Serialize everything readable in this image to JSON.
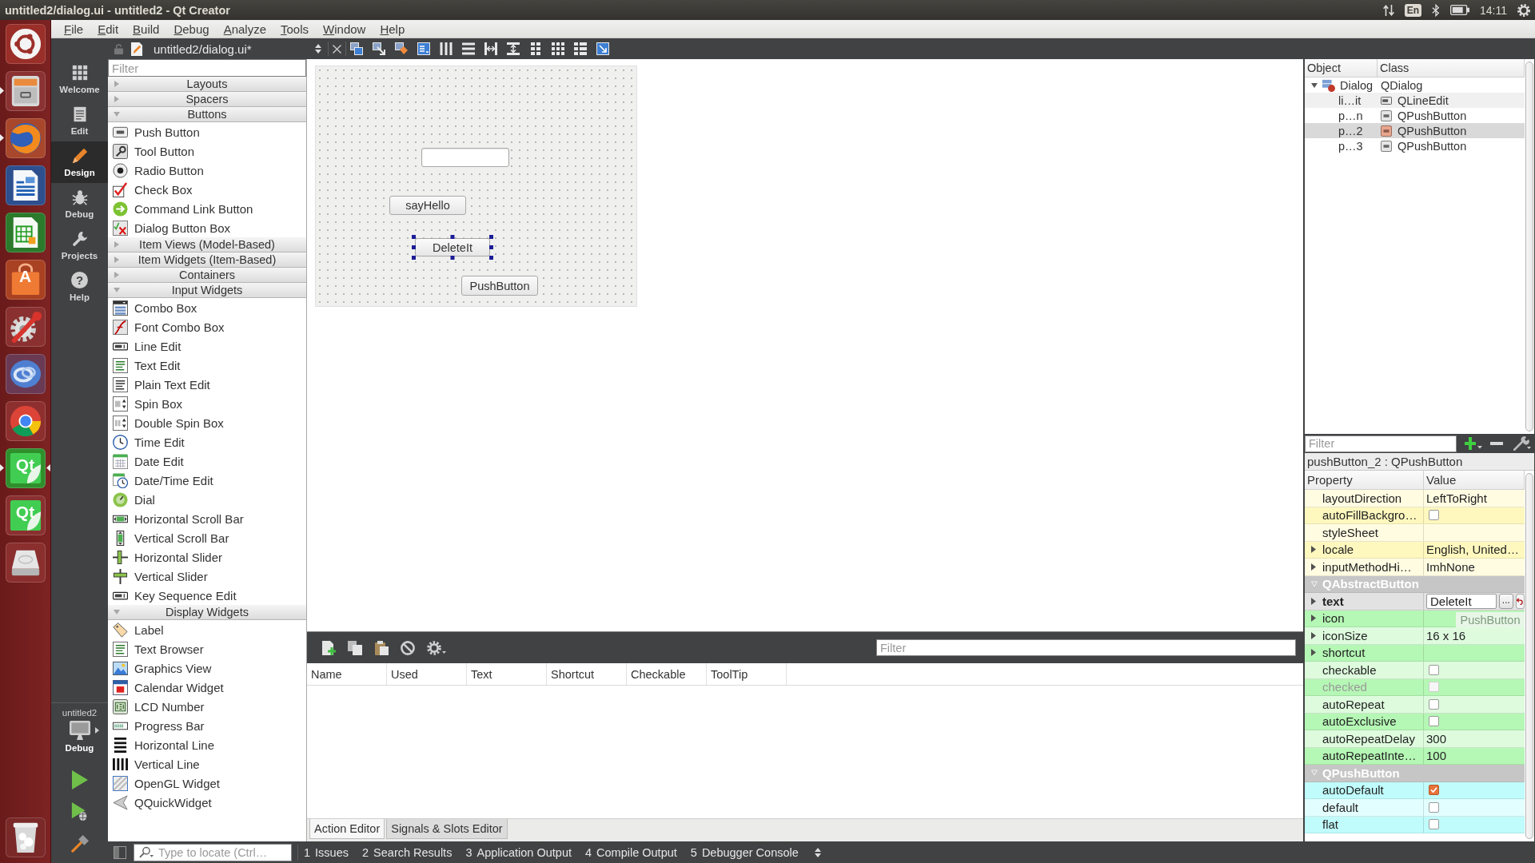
{
  "window": {
    "title": "untitled2/dialog.ui - untitled2 - Qt Creator"
  },
  "tray": {
    "keyboard": "En",
    "clock": "14:11"
  },
  "launcher": {
    "apps": [
      {
        "running": false,
        "focused": false
      },
      {
        "running": true,
        "focused": false
      },
      {
        "running": true,
        "focused": false
      },
      {
        "running": false,
        "focused": false
      },
      {
        "running": false,
        "focused": false
      },
      {
        "running": false,
        "focused": false,
        "logo_text": "A"
      },
      {
        "running": false,
        "focused": false
      },
      {
        "running": false,
        "focused": false
      },
      {
        "running": false,
        "focused": false
      },
      {
        "running": true,
        "focused": true,
        "logo_text": "Qt"
      },
      {
        "running": false,
        "focused": false,
        "logo_text": "Qt"
      },
      {
        "running": false,
        "focused": false
      }
    ]
  },
  "menu": [
    "File",
    "Edit",
    "Build",
    "Debug",
    "Analyze",
    "Tools",
    "Window",
    "Help"
  ],
  "modes": [
    {
      "label": "Welcome",
      "selected": false
    },
    {
      "label": "Edit",
      "selected": false
    },
    {
      "label": "Design",
      "selected": true
    },
    {
      "label": "Debug",
      "selected": false
    },
    {
      "label": "Projects",
      "selected": false
    },
    {
      "label": "Help",
      "selected": false,
      "glyph": "?"
    }
  ],
  "kit": {
    "project": "untitled2",
    "config": "Debug"
  },
  "editor": {
    "file": "untitled2/dialog.ui*"
  },
  "widget_box": {
    "placeholder": "Filter",
    "categories": [
      {
        "label": "Layouts",
        "expanded": false
      },
      {
        "label": "Spacers",
        "expanded": false
      },
      {
        "label": "Buttons",
        "expanded": true,
        "items": [
          "Push Button",
          "Tool Button",
          "Radio Button",
          "Check Box",
          "Command Link Button",
          "Dialog Button Box"
        ]
      },
      {
        "label": "Item Views (Model-Based)",
        "expanded": false
      },
      {
        "label": "Item Widgets (Item-Based)",
        "expanded": false
      },
      {
        "label": "Containers",
        "expanded": false
      },
      {
        "label": "Input Widgets",
        "expanded": true,
        "items": [
          "Combo Box",
          "Font Combo Box",
          "Line Edit",
          "Text Edit",
          "Plain Text Edit",
          "Spin Box",
          "Double Spin Box",
          "Time Edit",
          "Date Edit",
          "Date/Time Edit",
          "Dial",
          "Horizontal Scroll Bar",
          "Vertical Scroll Bar",
          "Horizontal Slider",
          "Vertical Slider",
          "Key Sequence Edit"
        ]
      },
      {
        "label": "Display Widgets",
        "expanded": true,
        "items": [
          "Label",
          "Text Browser",
          "Graphics View",
          "Calendar Widget",
          "LCD Number",
          "Progress Bar",
          "Horizontal Line",
          "Vertical Line",
          "OpenGL Widget",
          "QQuickWidget"
        ]
      }
    ]
  },
  "form": {
    "widgets": [
      {
        "kind": "line_edit",
        "selected": false
      },
      {
        "kind": "button",
        "text": "sayHello",
        "selected": false
      },
      {
        "kind": "button",
        "text": "DeleteIt",
        "selected": true
      },
      {
        "kind": "button",
        "text": "PushButton",
        "selected": false
      }
    ]
  },
  "action_editor": {
    "placeholder": "Filter",
    "columns": [
      "Name",
      "Used",
      "Text",
      "Shortcut",
      "Checkable",
      "ToolTip"
    ],
    "tabs": [
      {
        "label": "Action Editor",
        "selected": true
      },
      {
        "label": "Signals & Slots Editor",
        "selected": false
      }
    ]
  },
  "object_inspector": {
    "columns": [
      "Object",
      "Class"
    ],
    "tree": [
      {
        "object": "Dialog",
        "class": "QDialog",
        "kind": "dialog",
        "expanded": true,
        "selected": false,
        "children": [
          {
            "object": "li…it",
            "class": "QLineEdit",
            "kind": "line_edit",
            "selected": false
          },
          {
            "object": "p…n",
            "class": "QPushButton",
            "kind": "button",
            "selected": false
          },
          {
            "object": "p…2",
            "class": "QPushButton",
            "kind": "button",
            "selected": true
          },
          {
            "object": "p…3",
            "class": "QPushButton",
            "kind": "button",
            "selected": false
          }
        ]
      }
    ]
  },
  "property_editor": {
    "placeholder": "Filter",
    "object": "pushButton_2 : QPushButton",
    "columns": [
      "Property",
      "Value"
    ],
    "sections": [
      {
        "color": "#fff8be",
        "rows": [
          {
            "name": "layoutDirection",
            "kind": "text",
            "value": "LeftToRight",
            "expandable": false,
            "changed": false,
            "disabled": false,
            "selected": false
          },
          {
            "name": "autoFillBackgro…",
            "kind": "check",
            "checked": false,
            "expandable": false,
            "changed": false,
            "disabled": false,
            "selected": false
          },
          {
            "name": "styleSheet",
            "kind": "text",
            "expandable": false,
            "changed": false,
            "disabled": false,
            "selected": false
          },
          {
            "name": "locale",
            "kind": "text",
            "value": "English, United…",
            "expandable": true,
            "changed": false,
            "disabled": false,
            "selected": false
          },
          {
            "name": "inputMethodHi…",
            "kind": "text",
            "value": "ImhNone",
            "expandable": true,
            "changed": false,
            "disabled": false,
            "selected": false
          }
        ]
      },
      {
        "title": "QAbstractButton",
        "expanded": true,
        "color": "#b5f7b5",
        "rows": [
          {
            "name": "text",
            "kind": "editor",
            "value": "DeleteIt",
            "button": "...",
            "expandable": true,
            "changed": true,
            "disabled": false,
            "selected": true
          },
          {
            "name": "icon",
            "kind": "text",
            "expandable": true,
            "changed": false,
            "disabled": false,
            "selected": false
          },
          {
            "name": "iconSize",
            "kind": "text",
            "value": "16 x 16",
            "expandable": true,
            "changed": false,
            "disabled": false,
            "selected": false
          },
          {
            "name": "shortcut",
            "kind": "text",
            "expandable": true,
            "changed": false,
            "disabled": false,
            "selected": false
          },
          {
            "name": "checkable",
            "kind": "check",
            "checked": false,
            "expandable": false,
            "changed": false,
            "disabled": false,
            "selected": false
          },
          {
            "name": "checked",
            "kind": "check",
            "checked": false,
            "expandable": false,
            "changed": false,
            "disabled": true,
            "selected": false
          },
          {
            "name": "autoRepeat",
            "kind": "check",
            "checked": false,
            "expandable": false,
            "changed": false,
            "disabled": false,
            "selected": false
          },
          {
            "name": "autoExclusive",
            "kind": "check",
            "checked": false,
            "expandable": false,
            "changed": false,
            "disabled": false,
            "selected": false
          },
          {
            "name": "autoRepeatDelay",
            "kind": "text",
            "value": "300",
            "expandable": false,
            "changed": false,
            "disabled": false,
            "selected": false
          },
          {
            "name": "autoRepeatInte…",
            "kind": "text",
            "value": "100",
            "expandable": false,
            "changed": false,
            "disabled": false,
            "selected": false
          }
        ]
      },
      {
        "title": "QPushButton",
        "expanded": true,
        "color": "#c0fcfc",
        "rows": [
          {
            "name": "autoDefault",
            "kind": "check",
            "checked": true,
            "expandable": false,
            "changed": false,
            "disabled": false,
            "selected": false
          },
          {
            "name": "default",
            "kind": "check",
            "checked": false,
            "expandable": false,
            "changed": false,
            "disabled": false,
            "selected": false
          },
          {
            "name": "flat",
            "kind": "check",
            "checked": false,
            "expandable": false,
            "changed": false,
            "disabled": false,
            "selected": false
          }
        ]
      }
    ],
    "drag_preview": {
      "text": "PushButton"
    }
  },
  "status_bar": {
    "placeholder": "Type to locate (Ctrl…",
    "panes": [
      {
        "number": "1",
        "label": "Issues"
      },
      {
        "number": "2",
        "label": "Search Results"
      },
      {
        "number": "3",
        "label": "Application Output"
      },
      {
        "number": "4",
        "label": "Compile Output"
      },
      {
        "number": "5",
        "label": "Debugger Console"
      }
    ]
  }
}
